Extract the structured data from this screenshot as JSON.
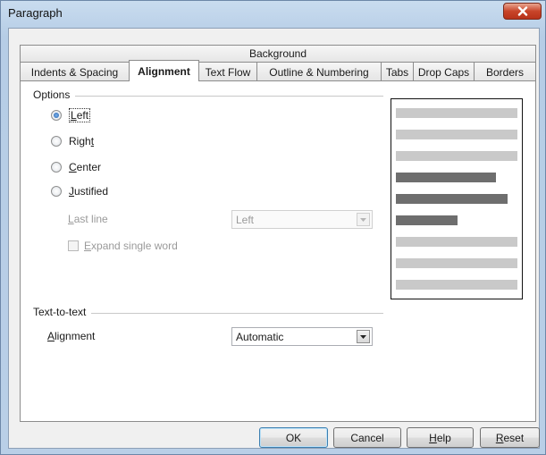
{
  "window": {
    "title": "Paragraph"
  },
  "tabs": {
    "top_row": "Background",
    "bottom_row": [
      {
        "label": "Indents & Spacing",
        "active": false
      },
      {
        "label": "Alignment",
        "active": true
      },
      {
        "label": "Text Flow",
        "active": false
      },
      {
        "label": "Outline & Numbering",
        "active": false
      },
      {
        "label": "Tabs",
        "active": false
      },
      {
        "label": "Drop Caps",
        "active": false
      },
      {
        "label": "Borders",
        "active": false
      }
    ]
  },
  "options": {
    "title": "Options",
    "radios": {
      "left": {
        "pre": "",
        "accel": "L",
        "post": "eft",
        "checked": true
      },
      "right": {
        "pre": "Righ",
        "accel": "t",
        "post": "",
        "checked": false
      },
      "center": {
        "pre": "",
        "accel": "C",
        "post": "enter",
        "checked": false
      },
      "justified": {
        "pre": "",
        "accel": "J",
        "post": "ustified",
        "checked": false
      }
    },
    "last_line": {
      "accel": "L",
      "post": "ast line",
      "value": "Left"
    },
    "expand_single_word": {
      "accel": "E",
      "post": "xpand single word",
      "checked": false
    }
  },
  "text_to_text": {
    "title": "Text-to-text",
    "alignment": {
      "accel": "A",
      "post": "lignment",
      "value": "Automatic"
    }
  },
  "buttons": {
    "ok": "OK",
    "cancel": "Cancel",
    "help": {
      "accel": "H",
      "post": "elp"
    },
    "reset": {
      "accel": "R",
      "post": "eset"
    }
  },
  "preview_colors": {
    "light": "#c9c9c9",
    "dark": "#6e6e6e"
  },
  "preview_lines": [
    {
      "fill": 1.0,
      "shade": "light"
    },
    {
      "fill": 1.0,
      "shade": "light"
    },
    {
      "fill": 1.0,
      "shade": "light"
    },
    {
      "fill": 0.82,
      "shade": "dark"
    },
    {
      "fill": 0.92,
      "shade": "dark"
    },
    {
      "fill": 0.51,
      "shade": "dark"
    },
    {
      "fill": 1.0,
      "shade": "light"
    },
    {
      "fill": 1.0,
      "shade": "light"
    },
    {
      "fill": 1.0,
      "shade": "light"
    }
  ]
}
